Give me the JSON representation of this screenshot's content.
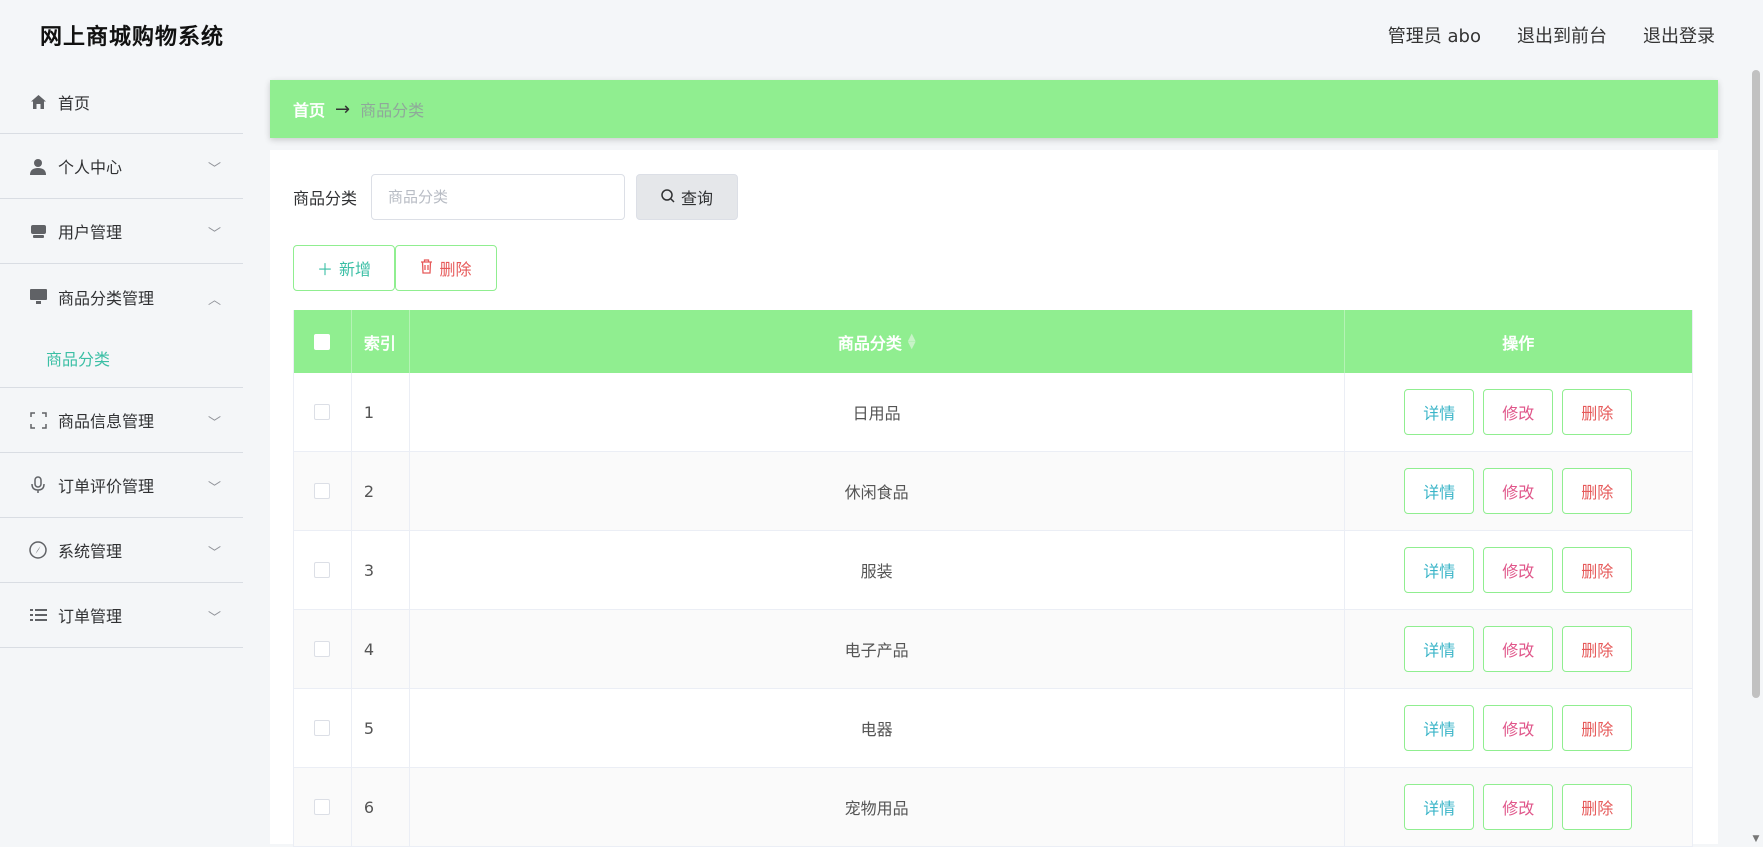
{
  "header": {
    "title": "网上商城购物系统",
    "user_label": "管理员 abo",
    "frontend_label": "退出到前台",
    "logout_label": "退出登录"
  },
  "sidebar": {
    "items": [
      {
        "label": "首页",
        "icon": "home-icon"
      },
      {
        "label": "个人中心",
        "icon": "user-icon"
      },
      {
        "label": "用户管理",
        "icon": "user-manage-icon"
      },
      {
        "label": "商品分类管理",
        "icon": "monitor-icon",
        "expanded": true,
        "children": [
          {
            "label": "商品分类",
            "active": true
          }
        ]
      },
      {
        "label": "商品信息管理",
        "icon": "fullscreen-icon"
      },
      {
        "label": "订单评价管理",
        "icon": "microphone-icon"
      },
      {
        "label": "系统管理",
        "icon": "compass-icon"
      },
      {
        "label": "订单管理",
        "icon": "list-icon"
      }
    ]
  },
  "breadcrumb": {
    "home": "首页",
    "current": "商品分类"
  },
  "search": {
    "label": "商品分类",
    "placeholder": "商品分类",
    "button": "查询"
  },
  "actions": {
    "add": "新增",
    "delete": "删除"
  },
  "table": {
    "headers": {
      "index": "索引",
      "name": "商品分类",
      "op": "操作"
    },
    "rows": [
      {
        "index": "1",
        "name": "日用品"
      },
      {
        "index": "2",
        "name": "休闲食品"
      },
      {
        "index": "3",
        "name": "服装"
      },
      {
        "index": "4",
        "name": "电子产品"
      },
      {
        "index": "5",
        "name": "电器"
      },
      {
        "index": "6",
        "name": "宠物用品"
      }
    ],
    "op_labels": {
      "detail": "详情",
      "edit": "修改",
      "delete": "删除"
    }
  },
  "colors": {
    "accent_green": "#90ee90",
    "active_text": "#3bbfa5",
    "danger": "#e65a5a",
    "edit": "#e0568a",
    "detail": "#3bb5c8"
  }
}
